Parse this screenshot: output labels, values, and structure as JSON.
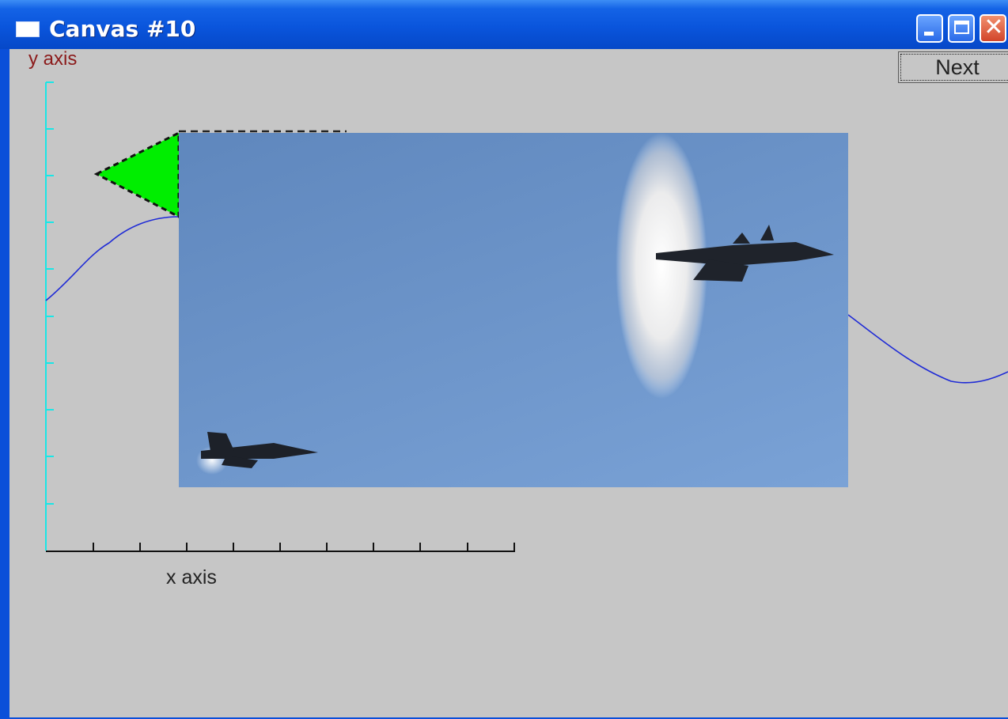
{
  "window": {
    "title": "Canvas #10",
    "controls": {
      "minimize": "minimize",
      "maximize": "maximize",
      "close": "close"
    }
  },
  "toolbar": {
    "next_label": "Next"
  },
  "graph": {
    "ylabel": "y axis",
    "xlabel": "x axis",
    "ylabel_color": "#8b1a1a",
    "yaxis_color": "#19e6e6",
    "curve_color": "#1f2bd6",
    "triangle_fill": "#00ee00"
  },
  "image": {
    "description_icon": "jet-photo"
  },
  "colors": {
    "titlebar": "#0a55dc",
    "canvas_bg": "#c6c6c6"
  }
}
